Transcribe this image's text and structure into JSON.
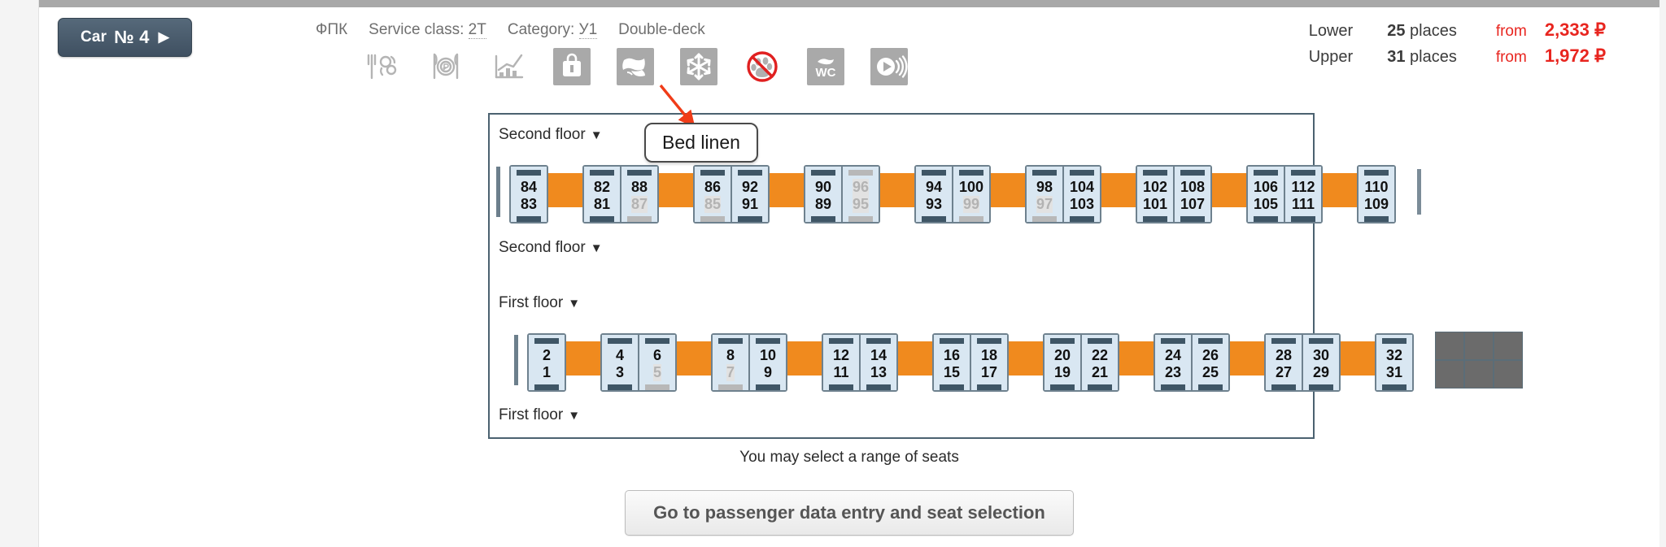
{
  "car_button": {
    "label": "Car",
    "number": "№ 4",
    "arrow": "▶"
  },
  "meta": {
    "carrier": "ФПК",
    "service_class_label": "Service class:",
    "service_class_value": "2Т",
    "category_label": "Category:",
    "category_value": "У1",
    "deck_type": "Double-deck"
  },
  "amenities": [
    {
      "name": "food-service-icon",
      "title": "Food service",
      "boxed": false
    },
    {
      "name": "paid-meal-icon",
      "title": "Paid meal",
      "boxed": false
    },
    {
      "name": "chart-icon",
      "title": "Dynamic pricing",
      "boxed": false
    },
    {
      "name": "luggage-icon",
      "title": "Luggage",
      "boxed": true
    },
    {
      "name": "bed-linen-icon",
      "title": "Bed linen",
      "boxed": true
    },
    {
      "name": "air-conditioning-icon",
      "title": "Air conditioning",
      "boxed": true
    },
    {
      "name": "no-pets-icon",
      "title": "No pets",
      "boxed": false
    },
    {
      "name": "wc-icon",
      "title": "WC",
      "boxed": true
    },
    {
      "name": "media-icon",
      "title": "Media",
      "boxed": true
    }
  ],
  "tooltip": {
    "text": "Bed linen",
    "arrow_color": "#f03c18"
  },
  "prices": {
    "rows": [
      {
        "deck": "Lower",
        "count": "25",
        "places_label": "places",
        "from_label": "from",
        "price": "2,333 ₽"
      },
      {
        "deck": "Upper",
        "count": "31",
        "places_label": "places",
        "from_label": "from",
        "price": "1,972 ₽"
      }
    ],
    "accent_color": "#e8251f"
  },
  "car_plan": {
    "labels": {
      "second_floor_top": "Second floor",
      "second_floor_bottom": "Second floor",
      "first_floor_top": "First floor",
      "first_floor_bottom": "First floor",
      "caret": "▼"
    },
    "second_floor": {
      "deck_name": "second-floor-deck",
      "items": [
        {
          "type": "wall"
        },
        {
          "type": "compartment",
          "seats": [
            {
              "upper": "84",
              "lower": "83",
              "upper_off": false,
              "lower_off": false
            }
          ]
        },
        {
          "type": "table"
        },
        {
          "type": "compartment",
          "seats": [
            {
              "upper": "82",
              "lower": "81",
              "upper_off": false,
              "lower_off": false
            },
            {
              "upper": "88",
              "lower": "87",
              "upper_off": false,
              "lower_off": true
            }
          ]
        },
        {
          "type": "table"
        },
        {
          "type": "compartment",
          "seats": [
            {
              "upper": "86",
              "lower": "85",
              "upper_off": false,
              "lower_off": true
            },
            {
              "upper": "92",
              "lower": "91",
              "upper_off": false,
              "lower_off": false
            }
          ]
        },
        {
          "type": "table"
        },
        {
          "type": "compartment",
          "seats": [
            {
              "upper": "90",
              "lower": "89",
              "upper_off": false,
              "lower_off": false
            },
            {
              "upper": "96",
              "lower": "95",
              "upper_off": true,
              "lower_off": true
            }
          ]
        },
        {
          "type": "table"
        },
        {
          "type": "compartment",
          "seats": [
            {
              "upper": "94",
              "lower": "93",
              "upper_off": false,
              "lower_off": false
            },
            {
              "upper": "100",
              "lower": "99",
              "upper_off": false,
              "lower_off": true
            }
          ]
        },
        {
          "type": "table"
        },
        {
          "type": "compartment",
          "seats": [
            {
              "upper": "98",
              "lower": "97",
              "upper_off": false,
              "lower_off": true
            },
            {
              "upper": "104",
              "lower": "103",
              "upper_off": false,
              "lower_off": false
            }
          ]
        },
        {
          "type": "table"
        },
        {
          "type": "compartment",
          "seats": [
            {
              "upper": "102",
              "lower": "101",
              "upper_off": false,
              "lower_off": false
            },
            {
              "upper": "108",
              "lower": "107",
              "upper_off": false,
              "lower_off": false
            }
          ]
        },
        {
          "type": "table"
        },
        {
          "type": "compartment",
          "seats": [
            {
              "upper": "106",
              "lower": "105",
              "upper_off": false,
              "lower_off": false
            },
            {
              "upper": "112",
              "lower": "111",
              "upper_off": false,
              "lower_off": false
            }
          ]
        },
        {
          "type": "table"
        },
        {
          "type": "compartment",
          "seats": [
            {
              "upper": "110",
              "lower": "109",
              "upper_off": false,
              "lower_off": false
            }
          ]
        },
        {
          "type": "divider"
        }
      ]
    },
    "first_floor": {
      "deck_name": "first-floor-deck",
      "items": [
        {
          "type": "wall"
        },
        {
          "type": "compartment",
          "seats": [
            {
              "upper": "2",
              "lower": "1",
              "upper_off": false,
              "lower_off": false
            }
          ]
        },
        {
          "type": "table"
        },
        {
          "type": "compartment",
          "seats": [
            {
              "upper": "4",
              "lower": "3",
              "upper_off": false,
              "lower_off": false
            },
            {
              "upper": "6",
              "lower": "5",
              "upper_off": false,
              "lower_off": true
            }
          ]
        },
        {
          "type": "table"
        },
        {
          "type": "compartment",
          "seats": [
            {
              "upper": "8",
              "lower": "7",
              "upper_off": false,
              "lower_off": true
            },
            {
              "upper": "10",
              "lower": "9",
              "upper_off": false,
              "lower_off": false
            }
          ]
        },
        {
          "type": "table"
        },
        {
          "type": "compartment",
          "seats": [
            {
              "upper": "12",
              "lower": "11",
              "upper_off": false,
              "lower_off": false
            },
            {
              "upper": "14",
              "lower": "13",
              "upper_off": false,
              "lower_off": false
            }
          ]
        },
        {
          "type": "table"
        },
        {
          "type": "compartment",
          "seats": [
            {
              "upper": "16",
              "lower": "15",
              "upper_off": false,
              "lower_off": false
            },
            {
              "upper": "18",
              "lower": "17",
              "upper_off": false,
              "lower_off": false
            }
          ]
        },
        {
          "type": "table"
        },
        {
          "type": "compartment",
          "seats": [
            {
              "upper": "20",
              "lower": "19",
              "upper_off": false,
              "lower_off": false
            },
            {
              "upper": "22",
              "lower": "21",
              "upper_off": false,
              "lower_off": false
            }
          ]
        },
        {
          "type": "table"
        },
        {
          "type": "compartment",
          "seats": [
            {
              "upper": "24",
              "lower": "23",
              "upper_off": false,
              "lower_off": false
            },
            {
              "upper": "26",
              "lower": "25",
              "upper_off": false,
              "lower_off": false
            }
          ]
        },
        {
          "type": "table"
        },
        {
          "type": "compartment",
          "seats": [
            {
              "upper": "28",
              "lower": "27",
              "upper_off": false,
              "lower_off": false
            },
            {
              "upper": "30",
              "lower": "29",
              "upper_off": false,
              "lower_off": false
            }
          ]
        },
        {
          "type": "table"
        },
        {
          "type": "compartment",
          "seats": [
            {
              "upper": "32",
              "lower": "31",
              "upper_off": false,
              "lower_off": false
            }
          ]
        },
        {
          "type": "service"
        }
      ]
    }
  },
  "footer": {
    "hint": "You may select a range of seats",
    "cta_label": "Go to passenger data entry and seat selection"
  }
}
